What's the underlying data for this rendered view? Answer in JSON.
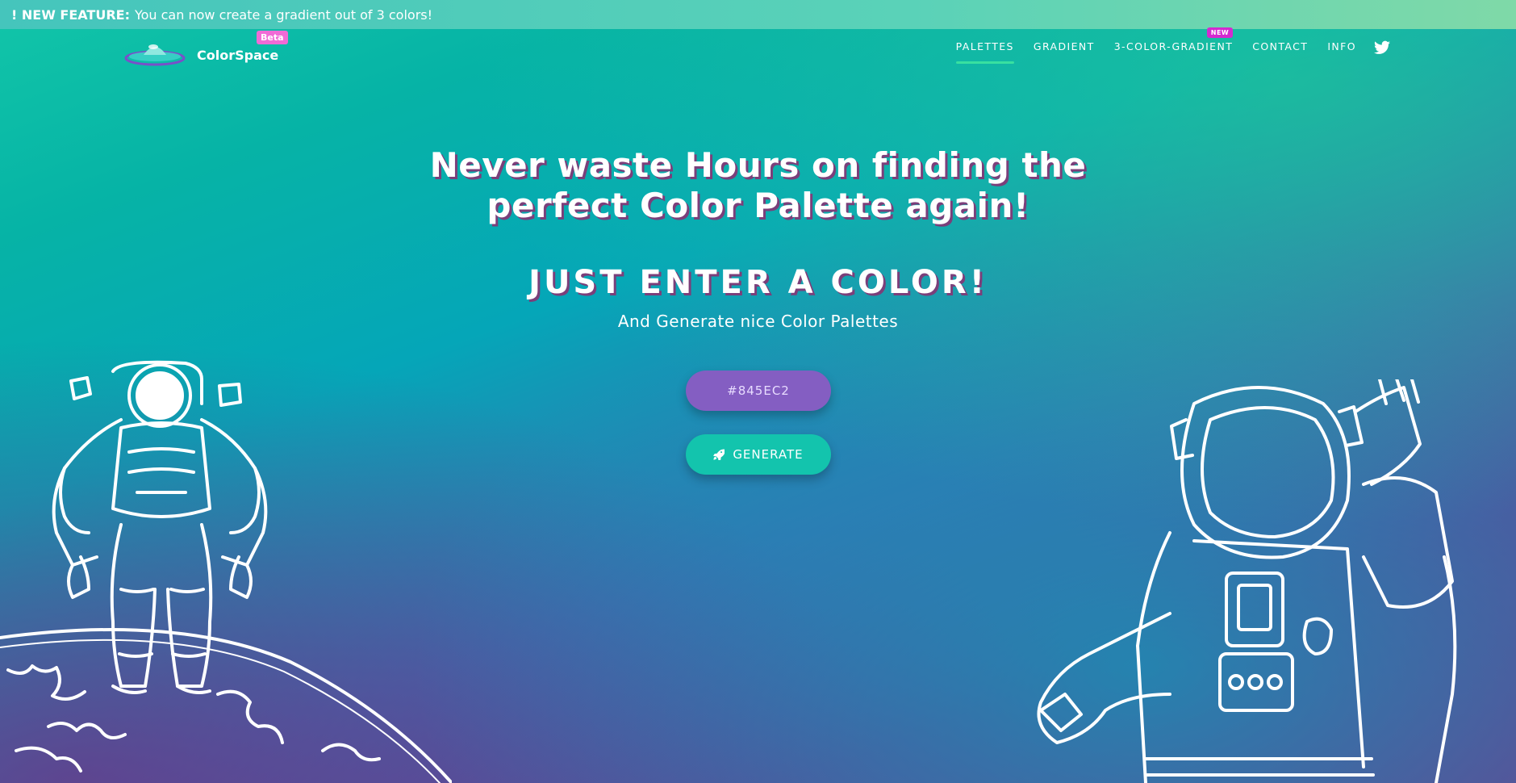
{
  "banner": {
    "prefix": "! NEW FEATURE:",
    "message": "You can now create a gradient out of 3 colors!"
  },
  "brand": {
    "name": "ColorSpace",
    "badge": "Beta"
  },
  "nav": {
    "items": [
      {
        "label": "PALETTES",
        "active": true
      },
      {
        "label": "GRADIENT"
      },
      {
        "label": "3-COLOR-GRADIENT",
        "badge": "NEW"
      },
      {
        "label": "CONTACT"
      },
      {
        "label": "INFO"
      }
    ],
    "twitter_icon": "twitter-icon"
  },
  "hero": {
    "headline_line1": "Never waste Hours on finding the",
    "headline_line2": "perfect Color Palette again!",
    "subhead": "JUST ENTER A COLOR!",
    "tagline": "And Generate nice Color Palettes"
  },
  "form": {
    "color_value": "#845EC2",
    "generate_label": "GENERATE",
    "generate_icon": "rocket-icon"
  },
  "colors": {
    "input_bg": "#845EC2",
    "button_bg": "#13C4AD",
    "beta_badge": "#F06BD6",
    "new_badge": "#D42AD0",
    "nav_active": "#38E0A0"
  }
}
